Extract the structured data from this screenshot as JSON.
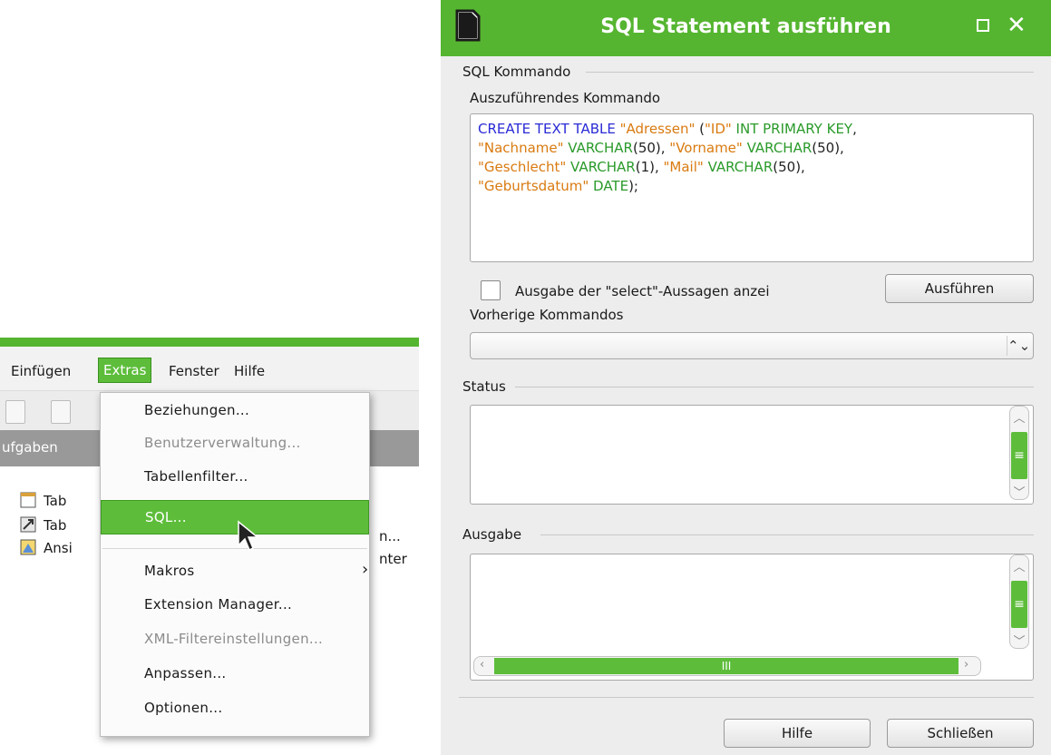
{
  "menubar": {
    "items": [
      "Einfügen",
      "Extras",
      "Fenster",
      "Hilfe"
    ]
  },
  "panel": {
    "header": "ufgaben"
  },
  "tasks": [
    {
      "label": "Tab",
      "right": "n..."
    },
    {
      "label": "Tab",
      "right": "nter"
    },
    {
      "label": "Ansi",
      "right": ""
    }
  ],
  "extras_menu": {
    "items": [
      {
        "label": "Beziehungen...",
        "enabled": true
      },
      {
        "label": "Benutzerverwaltung...",
        "enabled": false
      },
      {
        "label": "Tabellenfilter...",
        "enabled": true
      },
      {
        "label": "SQL...",
        "enabled": true,
        "highlighted": true
      },
      {
        "label": "Makros",
        "enabled": true,
        "submenu": true
      },
      {
        "label": "Extension Manager...",
        "enabled": true
      },
      {
        "label": "XML-Filtereinstellungen...",
        "enabled": false
      },
      {
        "label": "Anpassen...",
        "enabled": true
      },
      {
        "label": "Optionen...",
        "enabled": true
      }
    ]
  },
  "dialog": {
    "title": "SQL Statement ausführen",
    "group_sql": "SQL Kommando",
    "command_label": "Auszuführendes Kommando",
    "command_lines": [
      [
        [
          "kw",
          "CREATE TEXT TABLE "
        ],
        [
          "str",
          "\"Adressen\""
        ],
        [
          "pl",
          " ("
        ],
        [
          "str",
          "\"ID\""
        ],
        [
          "typ",
          " INT PRIMARY KEY"
        ],
        [
          "pl",
          ","
        ]
      ],
      [
        [
          "str",
          "\"Nachname\""
        ],
        [
          "typ",
          " VARCHAR"
        ],
        [
          "pl",
          "(50), "
        ],
        [
          "str",
          "\"Vorname\""
        ],
        [
          "typ",
          " VARCHAR"
        ],
        [
          "pl",
          "(50),"
        ]
      ],
      [
        [
          "str",
          "\"Geschlecht\""
        ],
        [
          "typ",
          " VARCHAR"
        ],
        [
          "pl",
          "(1), "
        ],
        [
          "str",
          "\"Mail\""
        ],
        [
          "typ",
          " VARCHAR"
        ],
        [
          "pl",
          "(50),"
        ]
      ],
      [
        [
          "str",
          "\"Geburtsdatum\""
        ],
        [
          "typ",
          " DATE"
        ],
        [
          "pl",
          ");"
        ]
      ]
    ],
    "show_select_label": "Ausgabe der \"select\"-Aussagen anzei",
    "execute_button": "Ausführen",
    "previous_label": "Vorherige Kommandos",
    "group_status": "Status",
    "group_output": "Ausgabe",
    "help_button": "Hilfe",
    "close_button": "Schließen"
  }
}
